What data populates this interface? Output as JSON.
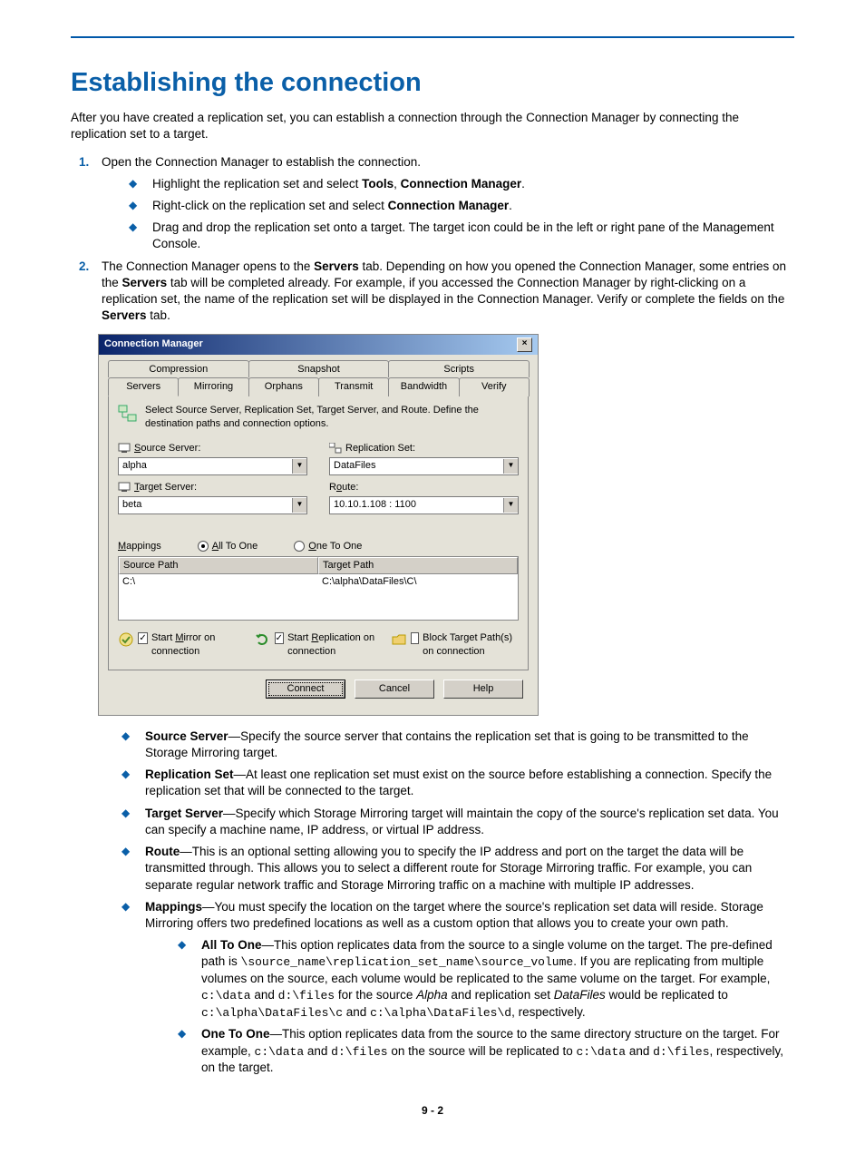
{
  "heading": "Establishing the connection",
  "intro": "After you have created a replication set, you can establish a connection through the Connection Manager by connecting the replication set to a target.",
  "step1": "Open the Connection Manager to establish the connection.",
  "step1_bullets": {
    "a_pre": "Highlight the replication set and select ",
    "a_b1": "Tools",
    "a_mid": ", ",
    "a_b2": "Connection Manager",
    "a_post": ".",
    "b_pre": "Right-click on the replication set and select ",
    "b_b": "Connection Manager",
    "b_post": ".",
    "c": "Drag and drop the replication set onto a target. The target icon could be in the left or right pane of the Management Console."
  },
  "step2": {
    "t1": "The Connection Manager opens to the ",
    "b1": "Servers",
    "t2": " tab. Depending on how you opened the Connection Manager, some entries on the ",
    "b2": "Servers",
    "t3": " tab will be completed already. For example, if you accessed the Connection Manager by right-clicking on a replication set, the name of the replication set will be displayed in the Connection Manager. Verify or complete the fields on the ",
    "b3": "Servers",
    "t4": " tab."
  },
  "dialog": {
    "title": "Connection Manager",
    "tabs_top": [
      "Compression",
      "Snapshot",
      "Scripts"
    ],
    "tabs_bottom": [
      "Servers",
      "Mirroring",
      "Orphans",
      "Transmit",
      "Bandwidth",
      "Verify"
    ],
    "helptext": "Select Source Server, Replication Set, Target Server, and Route.  Define the destination paths and connection options.",
    "labels": {
      "source_server": "Source Server:",
      "replication_set": "Replication Set:",
      "target_server": "Target Server:",
      "route": "Route:",
      "mappings": "Mappings",
      "all_to_one": "All To One",
      "one_to_one": "One To One",
      "source_path": "Source Path",
      "target_path": "Target Path"
    },
    "values": {
      "source_server": "alpha",
      "replication_set": "DataFiles",
      "target_server": "beta",
      "route": "10.10.1.108 : 1100",
      "source_path": "C:\\",
      "target_path": "C:\\alpha\\DataFiles\\C\\"
    },
    "checks": {
      "start_mirror": "Start Mirror on connection",
      "start_replication": "Start Replication on connection",
      "block_target": "Block Target Path(s) on connection"
    },
    "buttons": {
      "connect": "Connect",
      "cancel": "Cancel",
      "help": "Help"
    }
  },
  "defs": {
    "source_server": {
      "term": "Source Server",
      "text": "—Specify the source server that contains the replication set that is going to be transmitted to the Storage Mirroring target."
    },
    "replication_set": {
      "term": "Replication Set",
      "text": "—At least one replication set must exist on the source before establishing a connection. Specify the replication set that will be connected to the target."
    },
    "target_server": {
      "term": "Target Server",
      "text": "—Specify which Storage Mirroring target will maintain the copy of the source's replication set data. You can specify a machine name, IP address, or virtual IP address."
    },
    "route": {
      "term": "Route",
      "text": "—This is an optional setting allowing you to specify the IP address and port on the target the data will be transmitted through. This allows you to select a different route for Storage Mirroring traffic. For example, you can separate regular network traffic and Storage Mirroring traffic on a machine with multiple IP addresses."
    },
    "mappings": {
      "term": "Mappings",
      "text": "—You must specify the location on the target where the source's replication set data will reside. Storage Mirroring offers two predefined locations as well as a custom option that allows you to create your own path."
    },
    "all_to_one": {
      "term": "All To One",
      "t1": "—This option replicates data from the source to a single volume on the target. The pre-defined path is ",
      "c1": "\\source_name\\replication_set_name\\source_volume",
      "t2": ". If you are replicating from multiple volumes on the source, each volume would be replicated to the same volume on the target. For example, ",
      "c2": "c:\\data",
      "t3": " and ",
      "c3": "d:\\files",
      "t4": " for the source ",
      "i1": "Alpha",
      "t5": " and replication set ",
      "i2": "DataFiles",
      "t6": " would be replicated to ",
      "c4": "c:\\alpha\\DataFiles\\c",
      "t7": " and ",
      "c5": "c:\\alpha\\DataFiles\\d",
      "t8": ", respectively."
    },
    "one_to_one": {
      "term": "One To One",
      "t1": "—This option replicates data from the source to the same directory structure on the target. For example, ",
      "c1": "c:\\data",
      "t2": " and ",
      "c2": "d:\\files",
      "t3": " on the source will be replicated to ",
      "c3": "c:\\data",
      "t4": " and ",
      "c4": "d:\\files",
      "t5": ", respectively, on the target."
    }
  },
  "page_number": "9 - 2"
}
